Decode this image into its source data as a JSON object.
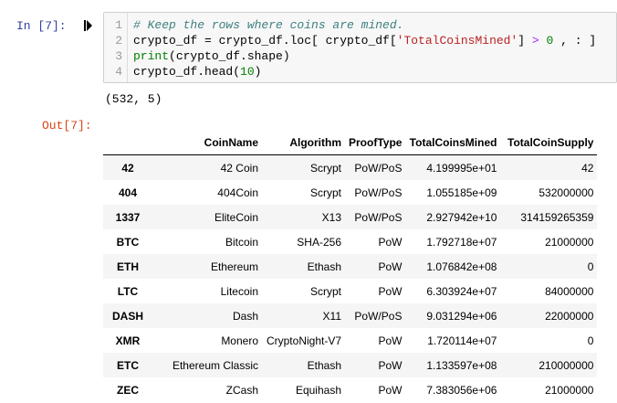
{
  "input_cell": {
    "prompt": "In [7]:",
    "lines": [
      {
        "number": "1",
        "segments": [
          {
            "cls": "c-comment",
            "text": "# Keep the rows where coins are mined."
          }
        ]
      },
      {
        "number": "2",
        "segments": [
          {
            "cls": "",
            "text": "crypto_df = crypto_df.loc[ crypto_df["
          },
          {
            "cls": "c-str",
            "text": "'TotalCoinsMined'"
          },
          {
            "cls": "",
            "text": "] "
          },
          {
            "cls": "c-op",
            "text": ">"
          },
          {
            "cls": "",
            "text": " "
          },
          {
            "cls": "c-num",
            "text": "0"
          },
          {
            "cls": "",
            "text": " , : ]"
          }
        ]
      },
      {
        "number": "3",
        "segments": [
          {
            "cls": "c-builtin",
            "text": "print"
          },
          {
            "cls": "",
            "text": "(crypto_df.shape)"
          }
        ]
      },
      {
        "number": "4",
        "segments": [
          {
            "cls": "",
            "text": "crypto_df.head("
          },
          {
            "cls": "c-num",
            "text": "10"
          },
          {
            "cls": "",
            "text": ")"
          }
        ]
      }
    ]
  },
  "stdout": "(532, 5)",
  "output_cell": {
    "prompt": "Out[7]:",
    "table": {
      "columns": [
        "",
        "CoinName",
        "Algorithm",
        "ProofType",
        "TotalCoinsMined",
        "TotalCoinSupply"
      ],
      "rows": [
        [
          "42",
          "42 Coin",
          "Scrypt",
          "PoW/PoS",
          "4.199995e+01",
          "42"
        ],
        [
          "404",
          "404Coin",
          "Scrypt",
          "PoW/PoS",
          "1.055185e+09",
          "532000000"
        ],
        [
          "1337",
          "EliteCoin",
          "X13",
          "PoW/PoS",
          "2.927942e+10",
          "314159265359"
        ],
        [
          "BTC",
          "Bitcoin",
          "SHA-256",
          "PoW",
          "1.792718e+07",
          "21000000"
        ],
        [
          "ETH",
          "Ethereum",
          "Ethash",
          "PoW",
          "1.076842e+08",
          "0"
        ],
        [
          "LTC",
          "Litecoin",
          "Scrypt",
          "PoW",
          "6.303924e+07",
          "84000000"
        ],
        [
          "DASH",
          "Dash",
          "X11",
          "PoW/PoS",
          "9.031294e+06",
          "22000000"
        ],
        [
          "XMR",
          "Monero",
          "CryptoNight-V7",
          "PoW",
          "1.720114e+07",
          "0"
        ],
        [
          "ETC",
          "Ethereum Classic",
          "Ethash",
          "PoW",
          "1.133597e+08",
          "210000000"
        ],
        [
          "ZEC",
          "ZCash",
          "Equihash",
          "PoW",
          "7.383056e+06",
          "21000000"
        ]
      ]
    }
  }
}
